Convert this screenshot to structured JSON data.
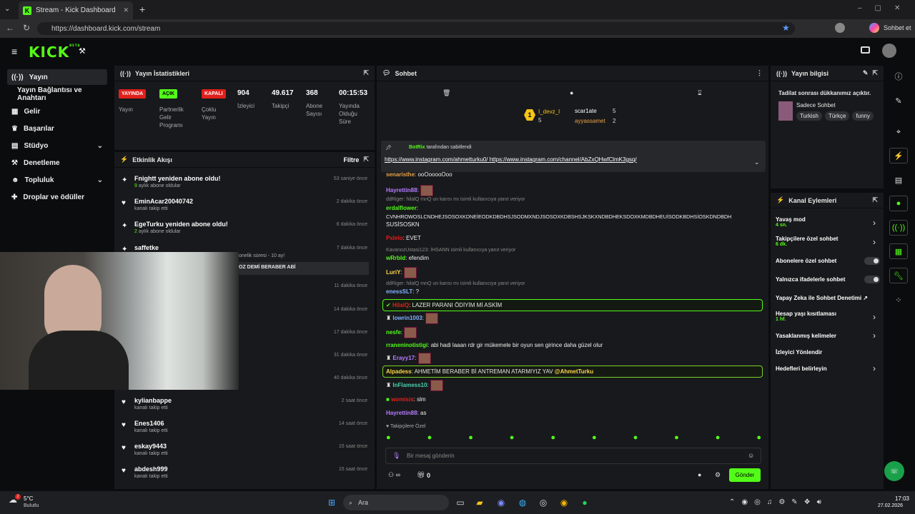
{
  "browser": {
    "tab_title": "Stream - Kick Dashboard",
    "url": "https://dashboard.kick.com/stream",
    "copilot_label": "Sohbet et"
  },
  "app": {
    "logo": "KICK",
    "logo_sup": "BETA"
  },
  "sidebar": {
    "items": [
      {
        "label": "Yayın",
        "icon": "broadcast-icon",
        "active": true
      },
      {
        "label": "Yayın Bağlantısı ve Anahtarı"
      },
      {
        "label": "Gelir",
        "icon": "bank-icon"
      },
      {
        "label": "Başarılar",
        "icon": "trophy-icon"
      },
      {
        "label": "Stüdyo",
        "icon": "grid-icon",
        "chevron": true
      },
      {
        "label": "Denetleme",
        "icon": "hammer-icon"
      },
      {
        "label": "Topluluk",
        "icon": "people-icon",
        "chevron": true
      },
      {
        "label": "Droplar ve ödüller",
        "icon": "gift-icon"
      }
    ]
  },
  "stats": {
    "title": "Yayın İstatistikleri",
    "badges": [
      {
        "text": "YAYINDA",
        "label": "Yayın",
        "color": "#e0201c"
      },
      {
        "text": "AÇIK",
        "label": "Partnerlik Gelir Programı",
        "color": "#53fc18"
      },
      {
        "text": "KAPALI",
        "label": "Çoklu Yayın",
        "color": "#e0201c"
      }
    ],
    "values": [
      {
        "value": "904",
        "label": "İzleyici"
      },
      {
        "value": "49.617",
        "label": "Takipçi"
      },
      {
        "value": "368",
        "label": "Abone Sayısı"
      },
      {
        "value": "00:15:53",
        "label": "Yayında Olduğu Süre"
      }
    ]
  },
  "activity": {
    "title": "Etkinlik Akışı",
    "filter": "Filtre",
    "items": [
      {
        "name": "Fnightt yeniden abone oldu!",
        "sub_num": "9",
        "sub": "aylık abone oldular",
        "time": "53 saniye önce",
        "icon": "sparkle-icon"
      },
      {
        "name": "EminAcar20040742",
        "sub": "kanalı takip etti",
        "time": "2 dakika önce",
        "icon": "heart-icon"
      },
      {
        "name": "EgeTurku yeniden abone oldu!",
        "sub_num": "2",
        "sub": "aylık abone oldular",
        "time": "6 dakika önce",
        "icon": "sparkle-icon"
      },
      {
        "name": "saffetke",
        "sub": "onelik süresi - 10 ay!",
        "time": "7 dakika önce",
        "icon": "sparkle-icon",
        "message": "OZ DEMİ BERABER ABİ"
      },
      {
        "time": "11 dakika önce"
      },
      {
        "time": "14 dakika önce"
      },
      {
        "time": "17 dakika önce"
      },
      {
        "time": "31 dakika önce"
      },
      {
        "time": "40 dakika önce"
      },
      {
        "name": "kylianbappe",
        "sub": "kanalı takip etti",
        "time": "2 saat önce",
        "icon": "heart-icon"
      },
      {
        "name": "Enes1406",
        "sub": "kanalı takip etti",
        "time": "14 saat önce",
        "icon": "heart-icon"
      },
      {
        "name": "eskay9443",
        "sub": "kanalı takip etti",
        "time": "15 saat önce",
        "icon": "heart-icon"
      },
      {
        "name": "abdesh999",
        "sub": "kanalı takip etti",
        "time": "15 saat önce",
        "icon": "heart-icon"
      }
    ]
  },
  "chat": {
    "title": "Sohbet",
    "leader": {
      "rank": "1",
      "name": "I_devz_I",
      "count": "5"
    },
    "top2": [
      {
        "name": "scar1ate",
        "count": "5"
      },
      {
        "name": "ayyassamet",
        "count": "2"
      }
    ],
    "pinned": {
      "by": "BotRix",
      "by_suffix": "tarafından sabitlendi",
      "link1": "https://www.instagram.com/ahmetturku0/",
      "link2": "https://www.instagram.com/channel/AbZxQHwfClmK3gsq/"
    },
    "messages": [
      {
        "user": "senaristhe",
        "text": "ooOooooOoo",
        "color": "#e8a44a"
      },
      {
        "user": "Hayrettin88",
        "text": "",
        "color": "#b67cff",
        "emote": true
      },
      {
        "reply": "ddRiger: hilalQ mnQ un karısı mı isimli kullanıcıya yanıt veriyor"
      },
      {
        "user": "erdalflower",
        "text": "",
        "color": "#53fc18"
      },
      {
        "text_only": "CVNHROWOSLCNDHEJSOSOXKDNEİEODKDBDHSJSODMXNDJSOSOXKDBSHSJKSKXNDBDHEKSDOXKMDBDHEUİSODKBDHSİOSKDNDBDH"
      },
      {
        "text_only": "SUSİSOSKN"
      },
      {
        "user": "Pxlelo",
        "text": "EVET",
        "color": "#e0201c"
      },
      {
        "reply": "KavanozUstasi123: İHSANN isimli kullanıcıya yanıt veriyor"
      },
      {
        "user": "wRrbld",
        "text": "efendim",
        "color": "#53fc18"
      },
      {
        "user": "LuriY",
        "text": "",
        "color": "#ffd84a",
        "emote": true
      },
      {
        "reply": "ddRiger: hilalQ mnQ un karısı mı isimli kullanıcıya yanıt veriyor"
      },
      {
        "user": "enessSLT",
        "text": "?",
        "color": "#7fb2ff"
      },
      {
        "user": "HilalQ",
        "text": "LAZER PARANI ÖDİYİM Mİ ASKİM",
        "color": "#e0201c",
        "highlight": true
      },
      {
        "user": "lowrin1003",
        "text": "",
        "color": "#7fb2ff",
        "emote": true
      },
      {
        "user": "nesfe",
        "text": "",
        "color": "#53fc18",
        "emote": true
      },
      {
        "user": "rraneninotistigi",
        "text": "abi hadi laaan rdr gir mükemele bir oyun sen girince daha güzel olur",
        "color": "#53fc18"
      },
      {
        "user": "Erayy17",
        "text": "",
        "color": "#b67cff",
        "emote": true
      },
      {
        "user": "Alpadess",
        "text": "AHMETİM BERABER Bİ ANTREMAN ATARMIYIZ YAV",
        "mention": "@AhmetTurku",
        "color": "#ffd84a",
        "highlight": true
      },
      {
        "user": "InFlamess10",
        "text": "",
        "color": "#4ad0b0",
        "emote": true
      },
      {
        "user": "womisis",
        "text": "slm",
        "color": "#e0201c"
      },
      {
        "user": "Hayrettin88",
        "text": "as",
        "color": "#b67cff"
      }
    ],
    "followers_only": "Takipçilere Özel",
    "input_placeholder": "Bir mesaj gönderin",
    "points": "0",
    "send": "Gönder"
  },
  "info": {
    "title": "Yayın bilgisi",
    "stream_title": "Tadilat sonrası dükkanımız açıktır.",
    "category": "Sadece Sohbet",
    "tags": [
      "Turkish",
      "Türkçe",
      "funny"
    ]
  },
  "actions": {
    "title": "Kanal Eylemleri",
    "items": [
      {
        "label": "Yavaş mod",
        "sub": "4 sn.",
        "type": "chevron"
      },
      {
        "label": "Takipçilere özel sohbet",
        "sub": "6 dk.",
        "type": "chevron"
      },
      {
        "label": "Abonelere özel sohbet",
        "type": "toggle"
      },
      {
        "label": "Yalnızca ifadelerle sohbet",
        "type": "toggle"
      },
      {
        "label": "Yapay Zeka ile Sohbet Denetimi",
        "type": "external"
      },
      {
        "label": "Hesap yaşı kısıtlaması",
        "sub": "1 hf.",
        "type": "chevron"
      },
      {
        "label": "Yasaklanmış kelimeler",
        "type": "chevron"
      },
      {
        "label": "İzleyici Yönlendir",
        "type": "none"
      },
      {
        "label": "Hedefleri belirleyin",
        "type": "chevron"
      }
    ]
  },
  "taskbar": {
    "weather_temp": "5°C",
    "weather_desc": "Bulutlu",
    "search": "Ara",
    "time": "17:03",
    "date": "27.02.2026",
    "notif": "2"
  }
}
